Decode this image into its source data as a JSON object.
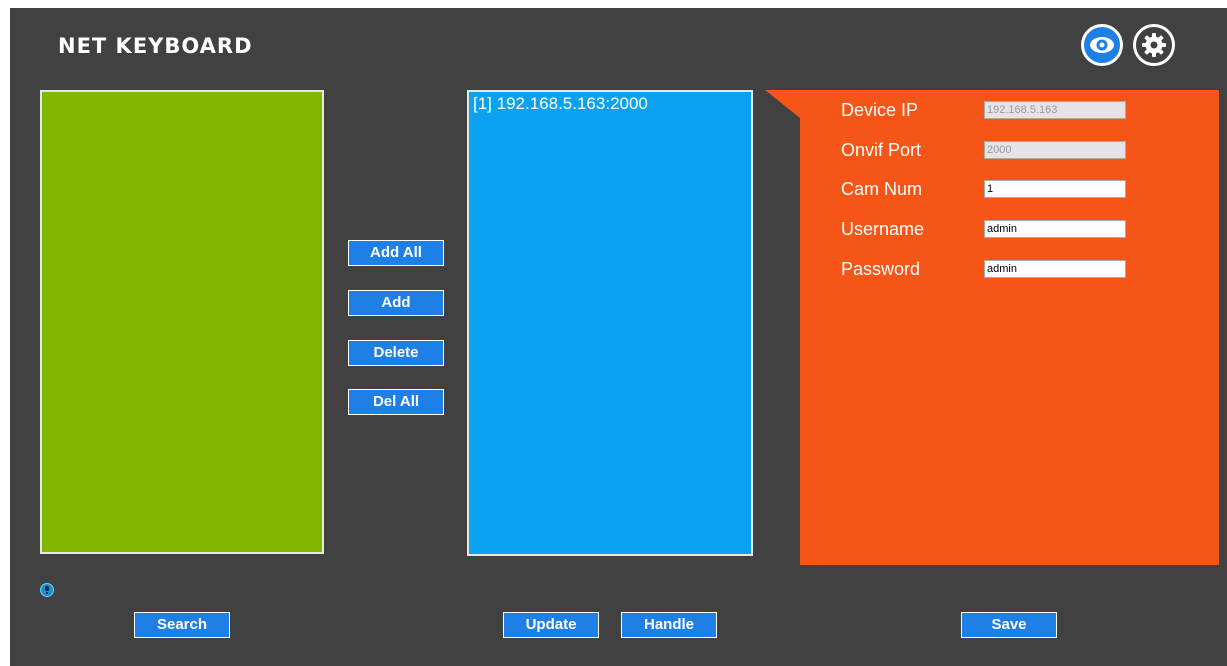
{
  "app": {
    "title": "NET KEYBOARD"
  },
  "toolbar": {
    "view_icon": "eye-icon",
    "settings_icon": "gear-icon"
  },
  "left_panel": {
    "color": "#80b800",
    "items": []
  },
  "transfer": {
    "add_all_label": "Add All",
    "add_label": "Add",
    "delete_label": "Delete",
    "del_all_label": "Del All"
  },
  "device_list": {
    "color": "#0aa2ee",
    "items": [
      "[1] 192.168.5.163:2000"
    ]
  },
  "device_form": {
    "color": "#f55517",
    "device_ip": {
      "label": "Device IP",
      "value": "192.168.5.163"
    },
    "onvif_port": {
      "label": "Onvif Port",
      "value": "2000"
    },
    "cam_num": {
      "label": "Cam Num",
      "value": "1"
    },
    "username": {
      "label": "Username",
      "value": "admin"
    },
    "password": {
      "label": "Password",
      "value": "admin"
    }
  },
  "footer": {
    "hint_icon": "lightbulb-icon",
    "search_label": "Search",
    "update_label": "Update",
    "handle_label": "Handle",
    "save_label": "Save"
  },
  "colors": {
    "background": "#414141",
    "accent": "#1e7fe6"
  }
}
